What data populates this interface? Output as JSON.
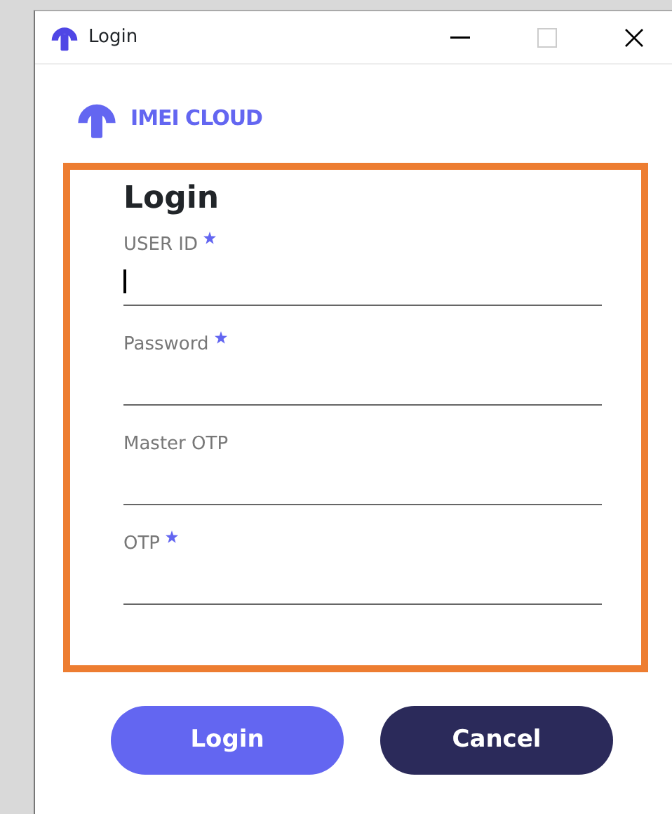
{
  "window": {
    "title": "Login"
  },
  "brand": {
    "name": "IMEI CLOUD"
  },
  "form": {
    "heading": "Login",
    "fields": [
      {
        "label": "USER ID",
        "required": true,
        "focused": true
      },
      {
        "label": "Password",
        "required": true,
        "focused": false
      },
      {
        "label": "Master OTP",
        "required": false,
        "focused": false
      },
      {
        "label": "OTP",
        "required": true,
        "focused": false
      }
    ]
  },
  "buttons": [
    {
      "label": "Login",
      "kind": "primary"
    },
    {
      "label": "Cancel",
      "kind": "secondary"
    }
  ]
}
